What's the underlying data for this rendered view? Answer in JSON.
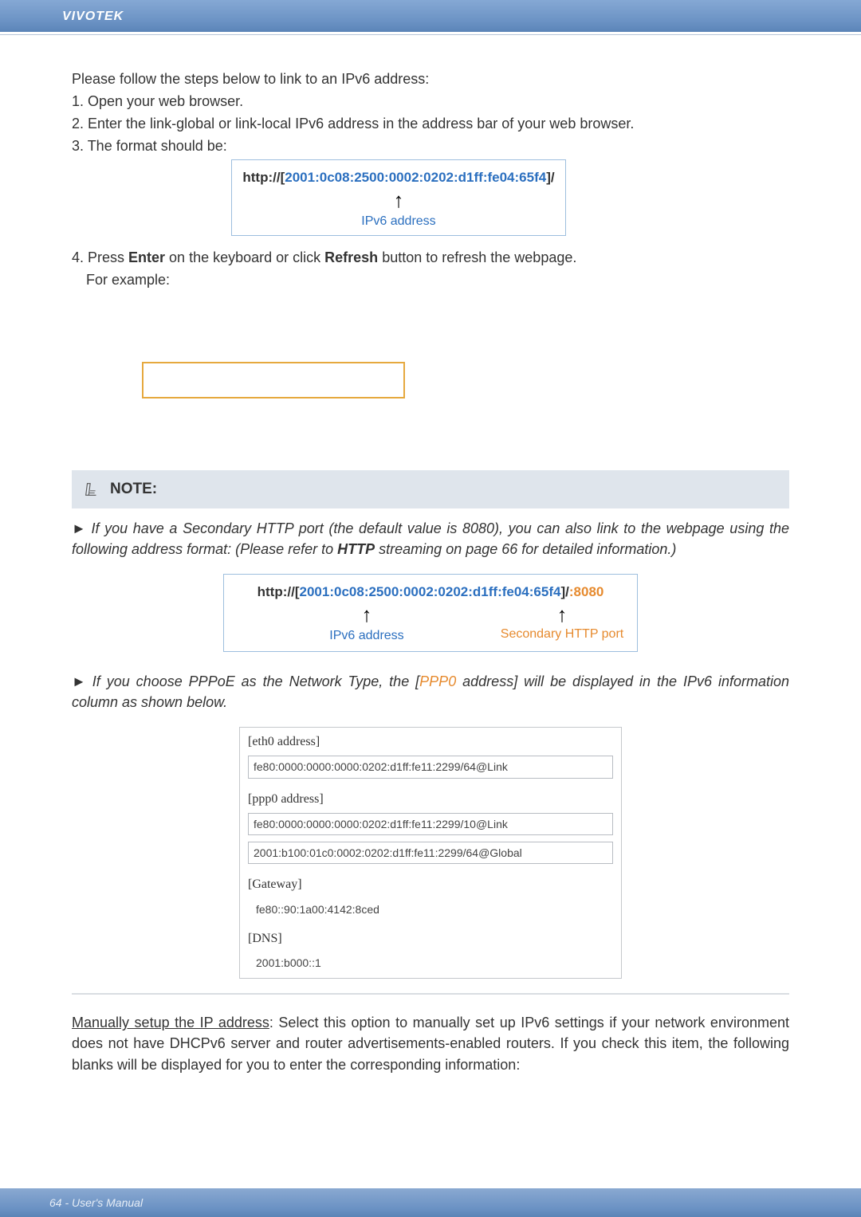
{
  "header": {
    "brand": "VIVOTEK"
  },
  "intro": "Please follow the steps below to link to an IPv6 address:",
  "steps": {
    "s1": "1. Open your web browser.",
    "s2": "2. Enter the link-global or link-local IPv6 address in the address bar of your web browser.",
    "s3": "3. The format should be:",
    "s4a": "4. Press ",
    "s4_enter": "Enter",
    "s4b": " on the keyboard or click ",
    "s4_refresh": "Refresh",
    "s4c": " button to refresh the webpage.",
    "s4_eg": "For example:"
  },
  "url1": {
    "prefix": "http://",
    "lbracket": "[",
    "ip": "2001:0c08:2500:0002:0202:d1ff:fe04:65f4",
    "rbracket": "]",
    "suffix": "/",
    "label": "IPv6 address"
  },
  "note": {
    "title": "NOTE:",
    "p1_a": "► If you have a Secondary HTTP port (the default value is 8080), you can also link to the webpage using the following address format: (Please refer to ",
    "p1_http": "HTTP",
    "p1_b": " streaming on page 66 for detailed information.)"
  },
  "url2": {
    "prefix": "http://",
    "lbracket": "[",
    "ip": "2001:0c08:2500:0002:0202:d1ff:fe04:65f4",
    "rbracket": "]",
    "slash": "/",
    "colon": ":",
    "port": "8080",
    "ip_label": "IPv6 address",
    "port_label": "Secondary HTTP port"
  },
  "note2": {
    "a": "► If you choose PPPoE as the Network Type, the [",
    "ppp": "PPP0",
    "b": " address] will be displayed in the IPv6 information column as shown below."
  },
  "info_panel": {
    "eth0_label": "[eth0 address]",
    "eth0_val": "fe80:0000:0000:0000:0202:d1ff:fe11:2299/64@Link",
    "ppp0_label": "[ppp0 address]",
    "ppp0_val1": "fe80:0000:0000:0000:0202:d1ff:fe11:2299/10@Link",
    "ppp0_val2": "2001:b100:01c0:0002:0202:d1ff:fe11:2299/64@Global",
    "gw_label": "[Gateway]",
    "gw_val": "fe80::90:1a00:4142:8ced",
    "dns_label": "[DNS]",
    "dns_val": "2001:b000::1"
  },
  "manual": {
    "ul": "Manually setup the IP address",
    "rest": ": Select this option to manually set up IPv6 settings if your network environment does not have DHCPv6 server and router advertisements-enabled routers. If you check this item, the following blanks will be displayed for you to enter the corresponding information:"
  },
  "footer": {
    "text": "64 - User's Manual"
  }
}
